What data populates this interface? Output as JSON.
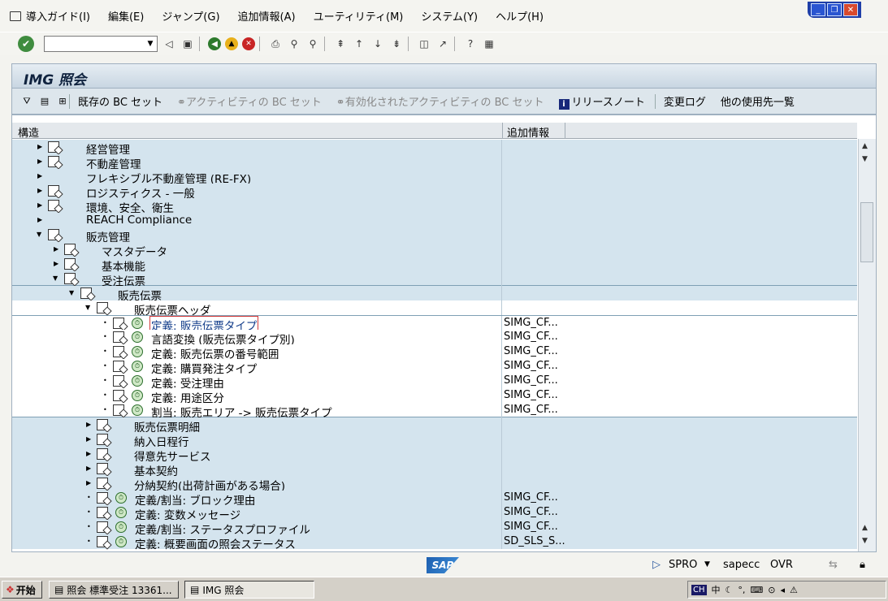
{
  "menubar": {
    "items": [
      "導入ガイド(I)",
      "編集(E)",
      "ジャンプ(G)",
      "追加情報(A)",
      "ユーティリティ(M)",
      "システム(Y)",
      "ヘルプ(H)"
    ]
  },
  "header": {
    "title": "IMG 照会"
  },
  "app_toolbar": {
    "existing_bc_set": "既存の BC セット",
    "activity_bc_set": "アクティビティの BC セット",
    "enabled_activity_bc_set": "有効化されたアクティビティの BC セット",
    "release_notes": "リリースノート",
    "change_log": "変更ログ",
    "where_used": "他の使用先一覧"
  },
  "grid": {
    "col_structure": "構造",
    "col_addinfo": "追加情報",
    "rows": [
      {
        "label": "経営管理",
        "info": ""
      },
      {
        "label": "不動産管理",
        "info": ""
      },
      {
        "label": "フレキシブル不動産管理 (RE-FX)",
        "info": ""
      },
      {
        "label": "ロジスティクス - 一般",
        "info": ""
      },
      {
        "label": "環境、安全、衛生",
        "info": ""
      },
      {
        "label": "REACH Compliance",
        "info": ""
      },
      {
        "label": "販売管理",
        "info": ""
      },
      {
        "label": "マスタデータ",
        "info": ""
      },
      {
        "label": "基本機能",
        "info": ""
      },
      {
        "label": "受注伝票",
        "info": ""
      },
      {
        "label": "販売伝票",
        "info": ""
      },
      {
        "label": "販売伝票ヘッダ",
        "info": ""
      },
      {
        "label": "定義: 販売伝票タイプ",
        "info": "SIMG_CF..."
      },
      {
        "label": "言語変換 (販売伝票タイプ別)",
        "info": "SIMG_CF..."
      },
      {
        "label": "定義: 販売伝票の番号範囲",
        "info": "SIMG_CF..."
      },
      {
        "label": "定義: 購買発注タイプ",
        "info": "SIMG_CF..."
      },
      {
        "label": "定義: 受注理由",
        "info": "SIMG_CF..."
      },
      {
        "label": "定義: 用途区分",
        "info": "SIMG_CF..."
      },
      {
        "label": "割当: 販売エリア -> 販売伝票タイプ",
        "info": "SIMG_CF..."
      },
      {
        "label": "販売伝票明細",
        "info": ""
      },
      {
        "label": "納入日程行",
        "info": ""
      },
      {
        "label": "得意先サービス",
        "info": ""
      },
      {
        "label": "基本契約",
        "info": ""
      },
      {
        "label": "分納契約(出荷計画がある場合)",
        "info": ""
      },
      {
        "label": "定義/割当: ブロック理由",
        "info": "SIMG_CF..."
      },
      {
        "label": "定義: 変数メッセージ",
        "info": "SIMG_CF..."
      },
      {
        "label": "定義/割当: ステータスプロファイル",
        "info": "SIMG_CF..."
      },
      {
        "label": "定義: 概要画面の照会ステータス",
        "info": "SD_SLS_S..."
      }
    ]
  },
  "status": {
    "logo": "SAP",
    "tcode": "SPRO",
    "server": "sapecc",
    "mode": "OVR"
  },
  "taskbar": {
    "start": "开始",
    "task1": "照会 標準受注 13361...",
    "task2": "IMG 照会",
    "ime": "CH",
    "lang": "中"
  }
}
